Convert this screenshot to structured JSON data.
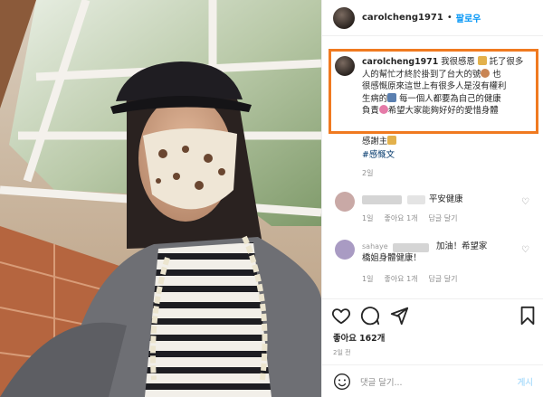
{
  "post": {
    "username": "carolcheng1971",
    "separator": "•",
    "follow_label": "팔로우",
    "caption_user": "carolcheng1971",
    "caption_line1": " 我很感恩",
    "caption_line1b": "託了很多",
    "caption_line2": "人的幫忙才終於掛到了台大的號",
    "caption_line2b": "也",
    "caption_line3": "很感慨原來這世上有很多人是沒有權利",
    "caption_line4a": "生病的",
    "caption_line4b": "每一個人都要為自己的健康",
    "caption_line5a": "負責",
    "caption_line5b": "希望大家能夠好好的愛惜身體",
    "thanks": "感謝主",
    "hashtag": "#感慨文",
    "age": "2일"
  },
  "comments": [
    {
      "text": "平安健康",
      "reply_time": "1일",
      "likes": "좋아요 1개",
      "reply_label": "답글 달기",
      "avatar_color": "#c9a9a6"
    },
    {
      "username_partial": "sahaye",
      "text_line1": "加油！希望家",
      "text_line2": "橋姐身體健康！",
      "reply_time": "1일",
      "likes": "좋아요 1개",
      "reply_label": "답글 달기",
      "avatar_color": "#a99bc3"
    }
  ],
  "engagement": {
    "likes": "좋아요 162개",
    "date": "2일 전"
  },
  "comment_box": {
    "placeholder": "댓글 달기...",
    "post_label": "게시"
  },
  "icons": {
    "like": "heart-icon",
    "comment": "comment-icon",
    "share": "share-icon",
    "save": "bookmark-icon",
    "emoji": "smile-icon"
  },
  "colors": {
    "highlight_border": "#f07a20",
    "follow": "#0095f6",
    "hashtag": "#00376b",
    "muted": "#8e8e8e"
  }
}
